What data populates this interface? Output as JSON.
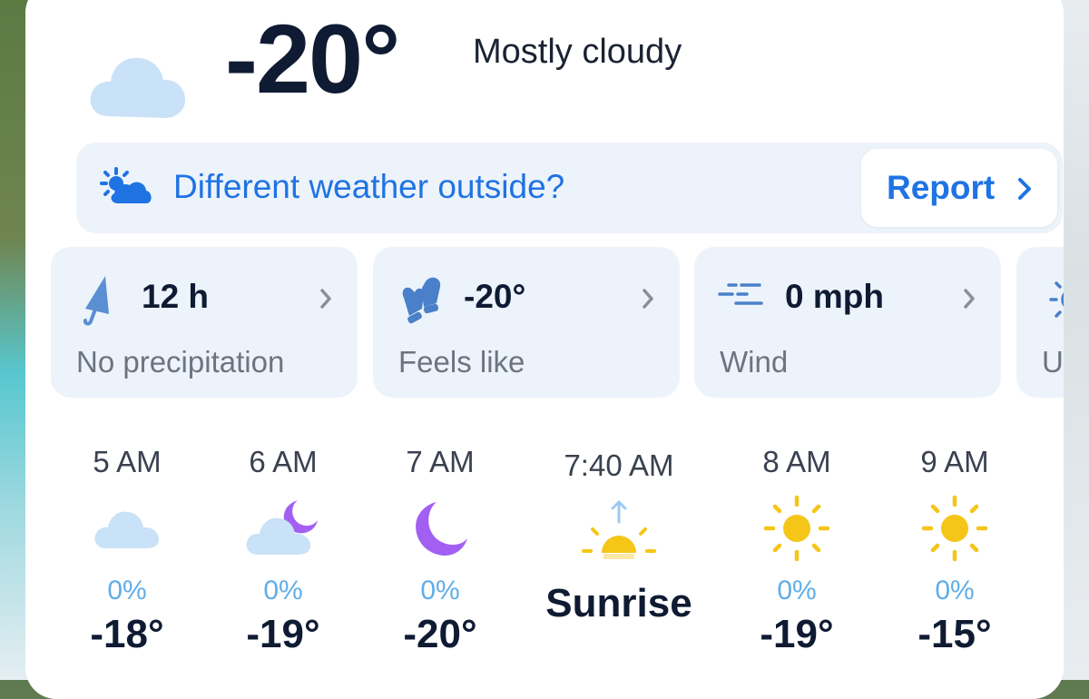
{
  "header": {
    "temperature": "-20°",
    "condition": "Mostly cloudy",
    "icon": "cloud-icon"
  },
  "report": {
    "prompt": "Different weather outside?",
    "button": "Report",
    "icon": "sun-cloud-icon"
  },
  "metrics": [
    {
      "value": "12 h",
      "label": "No precipitation",
      "icon": "umbrella-icon"
    },
    {
      "value": "-20°",
      "label": "Feels like",
      "icon": "mittens-icon"
    },
    {
      "value": "0 mph",
      "label": "Wind",
      "icon": "wind-icon"
    },
    {
      "value": "",
      "label": "U",
      "icon": "sun-icon"
    }
  ],
  "hourly": [
    {
      "time": "5 AM",
      "icon": "cloud-icon",
      "precip": "0%",
      "temp": "-18°"
    },
    {
      "time": "6 AM",
      "icon": "moon-cloud-icon",
      "precip": "0%",
      "temp": "-19°"
    },
    {
      "time": "7 AM",
      "icon": "moon-icon",
      "precip": "0%",
      "temp": "-20°"
    },
    {
      "time": "7:40 AM",
      "icon": "sunrise-icon",
      "precip": "",
      "temp": "Sunrise"
    },
    {
      "time": "8 AM",
      "icon": "sun-icon",
      "precip": "0%",
      "temp": "-19°"
    },
    {
      "time": "9 AM",
      "icon": "sun-icon",
      "precip": "0%",
      "temp": "-15°"
    }
  ],
  "colors": {
    "accent": "#1f73e3",
    "precip": "#60aee8",
    "sun": "#f5c518",
    "moon": "#a35ff2",
    "cloud": "#c9e2f7"
  }
}
